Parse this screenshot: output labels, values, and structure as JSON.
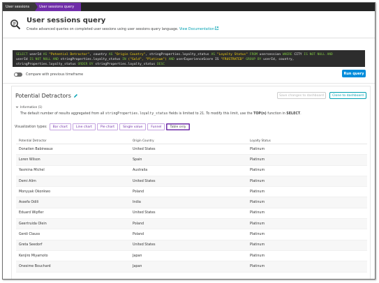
{
  "breadcrumb": {
    "items": [
      "User sessions",
      "User sessions query"
    ]
  },
  "header": {
    "title": "User sessions query",
    "subtitle": "Create advanced queries on completed user sessions using user sessions query language.",
    "doc_link": "View Documentation"
  },
  "query": {
    "line1": [
      {
        "t": "SELECT ",
        "c": "kw"
      },
      {
        "t": "userId ",
        "c": ""
      },
      {
        "t": "AS ",
        "c": "kw"
      },
      {
        "t": "\"Potential Detractor\"",
        "c": "str"
      },
      {
        "t": ", country ",
        "c": ""
      },
      {
        "t": "AS ",
        "c": "kw"
      },
      {
        "t": "\"Origin Country\"",
        "c": "str"
      },
      {
        "t": ", stringProperties.loyalty_status ",
        "c": ""
      },
      {
        "t": "AS ",
        "c": "kw"
      },
      {
        "t": "\"Loyalty Status\"",
        "c": "str"
      },
      {
        "t": " FROM ",
        "c": "kw"
      },
      {
        "t": "usersession ",
        "c": ""
      },
      {
        "t": "WHERE ",
        "c": "kw"
      },
      {
        "t": "CITY ",
        "c": ""
      },
      {
        "t": "IS NOT NULL ",
        "c": "kw"
      },
      {
        "t": "AND",
        "c": "kw"
      }
    ],
    "line2": [
      {
        "t": "userId ",
        "c": ""
      },
      {
        "t": "IS NOT NULL AND ",
        "c": "kw"
      },
      {
        "t": "stringProperties.loyalty_status ",
        "c": ""
      },
      {
        "t": "IN ",
        "c": "kw"
      },
      {
        "t": "(\"Gold\", \"Platinum\") ",
        "c": "str"
      },
      {
        "t": "AND ",
        "c": "kw"
      },
      {
        "t": "userExperienceScore IS ",
        "c": ""
      },
      {
        "t": "\"FRUSTRATED\" ",
        "c": "str"
      },
      {
        "t": "GROUP BY ",
        "c": "kw"
      },
      {
        "t": "userId, country,",
        "c": ""
      }
    ],
    "line3": [
      {
        "t": "stringProperties.loyalty_status ",
        "c": ""
      },
      {
        "t": "ORDER BY ",
        "c": "kw"
      },
      {
        "t": "stringProperties.loyalty_status ",
        "c": ""
      },
      {
        "t": "DESC",
        "c": "kw"
      }
    ]
  },
  "compare": {
    "label": "Compare with previous timeframe",
    "enabled": false
  },
  "run_button": "Run query",
  "panel": {
    "title": "Potential Detractors",
    "save_button": "Save changes to dashboard",
    "clone_button": "Clone to dashboard",
    "info_toggle": "Information (1)",
    "info_text_pre": "The default number of results aggregated from all ",
    "info_text_code": "stringProperties.loyalty_status",
    "info_text_mid": " fields is limited to 21. To modify this limit, use the ",
    "info_text_bold": "TOP(n)",
    "info_text_mid2": " function in ",
    "info_text_bold2": "SELECT",
    "info_text_end": "."
  },
  "visualization": {
    "label": "Visualization types:",
    "options": [
      "Bar chart",
      "Line chart",
      "Pie chart",
      "Single value",
      "Funnel",
      "Table only"
    ],
    "selected": "Table only"
  },
  "table": {
    "columns": [
      "Potential Detractor",
      "Origin Country",
      "Loyalty Status"
    ],
    "rows": [
      [
        "Donatien Babineaux",
        "United States",
        "Platinum"
      ],
      [
        "Loren Wilson",
        "Spain",
        "Platinum"
      ],
      [
        "Yasmina Michel",
        "Australia",
        "Platinum"
      ],
      [
        "Demi Alim",
        "United States",
        "Platinum"
      ],
      [
        "Monyyak Okonkwo",
        "Poland",
        "Platinum"
      ],
      [
        "Assefa Odili",
        "India",
        "Platinum"
      ],
      [
        "Eduard Wipfler",
        "United States",
        "Platinum"
      ],
      [
        "Geertruida Olein",
        "Poland",
        "Platinum"
      ],
      [
        "Gerdi Clauss",
        "Poland",
        "Platinum"
      ],
      [
        "Greta Seedorf",
        "United States",
        "Platinum"
      ],
      [
        "Kenjiro Miyamoto",
        "Japan",
        "Platinum"
      ],
      [
        "Onesime Bouchard",
        "Japan",
        "Platinum"
      ]
    ]
  }
}
